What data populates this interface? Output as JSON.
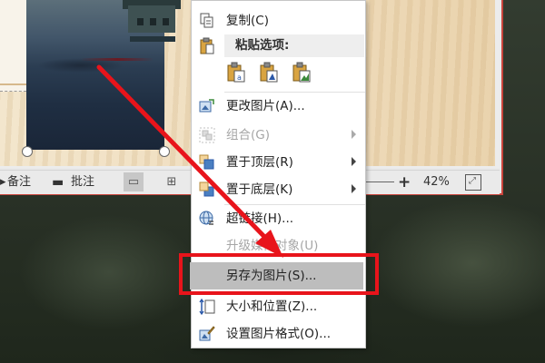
{
  "status_bar": {
    "notes_label": "备注",
    "comments_label": "批注",
    "zoom": "42%",
    "zoom_plus": "+"
  },
  "context_menu": {
    "items": [
      {
        "id": "copy",
        "label": "复制(C)",
        "icon": "copy-icon",
        "disabled": false
      },
      {
        "id": "paste_options_header",
        "label": "粘贴选项:",
        "icon": "paste-icon"
      },
      {
        "id": "change_picture",
        "label": "更改图片(A)...",
        "icon": "change-picture-icon",
        "disabled": false
      },
      {
        "id": "group",
        "label": "组合(G)",
        "icon": "group-icon",
        "disabled": true,
        "submenu": true
      },
      {
        "id": "bring_front",
        "label": "置于顶层(R)",
        "icon": "bring-to-front-icon",
        "disabled": false,
        "submenu": true
      },
      {
        "id": "send_back",
        "label": "置于底层(K)",
        "icon": "send-to-back-icon",
        "disabled": false,
        "submenu": true
      },
      {
        "id": "hyperlink",
        "label": "超链接(H)...",
        "icon": "hyperlink-icon",
        "disabled": false
      },
      {
        "id": "upgrade_media",
        "label": "升级媒体对象(U)",
        "icon": "",
        "disabled": true
      },
      {
        "id": "save_as_picture",
        "label": "另存为图片(S)...",
        "icon": "",
        "disabled": false,
        "highlighted": true
      },
      {
        "id": "size_position",
        "label": "大小和位置(Z)...",
        "icon": "size-position-icon",
        "disabled": false
      },
      {
        "id": "format_picture",
        "label": "设置图片格式(O)...",
        "icon": "format-picture-icon",
        "disabled": false
      }
    ],
    "paste_options": [
      "paste-keep-source-icon",
      "paste-picture-icon",
      "paste-keep-text-icon"
    ]
  },
  "colors": {
    "highlight_box": "#e8141b",
    "annotation_arrow": "#e8141b",
    "menu_highlight": "#bdbdbd",
    "window_border": "#c9443c"
  }
}
